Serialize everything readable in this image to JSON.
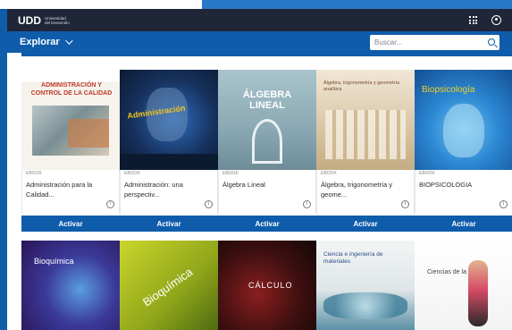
{
  "header": {
    "logo_mark": "UDD",
    "logo_line1": "Universidad",
    "logo_line2": "del Desarrollo"
  },
  "nav": {
    "explore_label": "Explorar",
    "search_placeholder": "Buscar..."
  },
  "colors": {
    "primary": "#0f5cab",
    "topbar": "#1f2637"
  },
  "books_row1": [
    {
      "cover_title": "ADMINISTRACIÓN Y CONTROL DE LA CALIDAD",
      "tag": "EBOOK",
      "title": "Administración para la Calidad...",
      "button": "Activar"
    },
    {
      "cover_title": "Administración",
      "tag": "EBOOK",
      "title": "Administración: una perspectiv...",
      "button": "Activar"
    },
    {
      "cover_title": "ÁLGEBRA LINEAL",
      "tag": "EBOOK",
      "title": "Álgebra Lineal",
      "button": "Activar"
    },
    {
      "cover_title": "Álgebra, trigonometría y geometría analítica",
      "tag": "EBOOK",
      "title": "Álgebra, trigonometría y geome...",
      "button": "Activar"
    },
    {
      "cover_title": "Biopsicología",
      "tag": "EBOOK",
      "title": "BIOPSICOLOGIA",
      "button": "Activar"
    }
  ],
  "books_row2": [
    {
      "cover_title": "Bioquímica"
    },
    {
      "cover_title": "Bioquímica"
    },
    {
      "cover_title": "CÁLCULO"
    },
    {
      "cover_title": "Ciencia e ingeniería de materiales"
    },
    {
      "cover_title": "Ciencias de la salud"
    }
  ]
}
